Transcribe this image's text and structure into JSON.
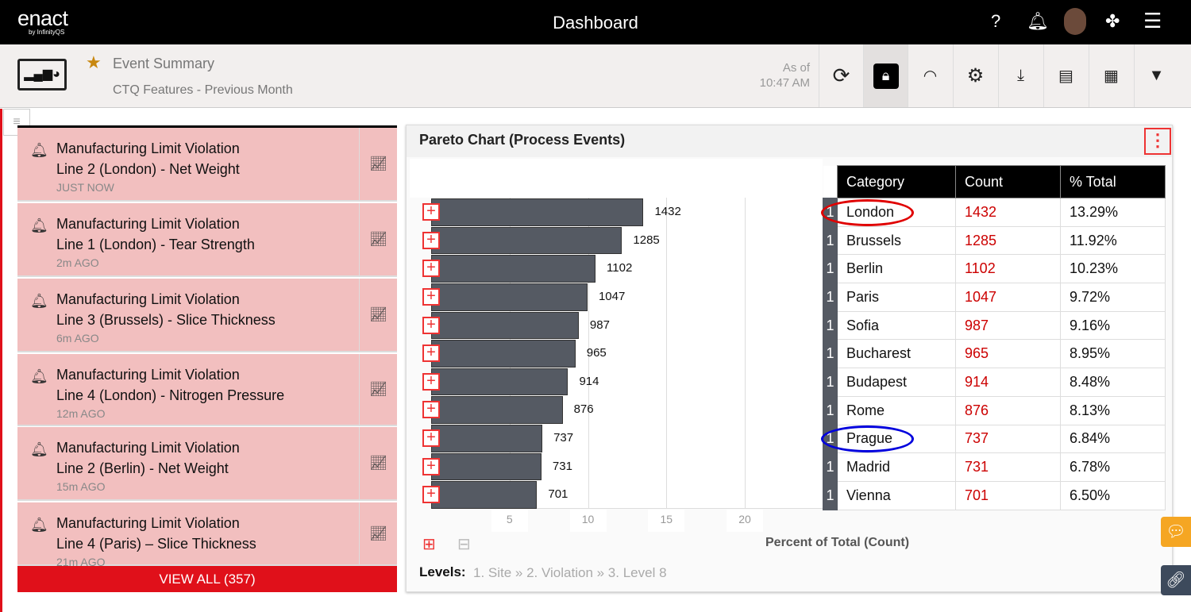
{
  "app": {
    "logo": "enact",
    "logo_sub": "by InfinityQS",
    "title": "Dashboard"
  },
  "topbar_icons": [
    "help-icon",
    "bell-icon",
    "avatar",
    "community-icon",
    "menu-icon"
  ],
  "header": {
    "title": "Event Summary",
    "subtitle": "CTQ Features - Previous Month",
    "as_of": "As of",
    "time": "10:47 AM",
    "favorite": true
  },
  "toolbar": [
    "refresh-icon",
    "lock-icon",
    "gauge-icon",
    "gear-icon",
    "download-icon",
    "document-icon",
    "report-filter-icon",
    "filter-icon"
  ],
  "events": [
    {
      "title": "Manufacturing Limit Violation",
      "detail": "Line 2 (London) - Net Weight",
      "time": "JUST NOW"
    },
    {
      "title": "Manufacturing Limit Violation",
      "detail": "Line 1 (London) - Tear Strength",
      "time": "2m AGO"
    },
    {
      "title": "Manufacturing Limit Violation",
      "detail": "Line 3 (Brussels) - Slice Thickness",
      "time": "6m AGO"
    },
    {
      "title": "Manufacturing Limit Violation",
      "detail": "Line 4 (London) - Nitrogen Pressure",
      "time": "12m AGO"
    },
    {
      "title": "Manufacturing Limit Violation",
      "detail": "Line 2 (Berlin) - Net Weight",
      "time": "15m AGO"
    },
    {
      "title": "Manufacturing Limit Violation",
      "detail": "Line 4 (Paris) – Slice Thickness",
      "time": "21m AGO"
    }
  ],
  "view_all": "VIEW ALL (357)",
  "panel": {
    "title": "Pareto Chart (Process Events)",
    "levels_label": "Levels:",
    "levels": "1. Site » 2. Violation » 3. Level 8"
  },
  "chart_data": {
    "type": "bar",
    "orientation": "horizontal",
    "xlabel": "Percent of Total (Count)",
    "xticks": [
      "5",
      "10",
      "15",
      "20"
    ],
    "xlim": [
      0,
      25
    ],
    "grid": true,
    "bar_color": "#555a63",
    "columns": [
      "Category",
      "Count",
      "% Total"
    ],
    "categories": [
      "London",
      "Brussels",
      "Berlin",
      "Paris",
      "Sofia",
      "Bucharest",
      "Budapest",
      "Rome",
      "Prague",
      "Madrid",
      "Vienna"
    ],
    "counts": [
      1432,
      1285,
      1102,
      1047,
      987,
      965,
      914,
      876,
      737,
      731,
      701
    ],
    "percent_labels": [
      "13.29%",
      "11.92%",
      "10.23%",
      "9.72%",
      "9.16%",
      "8.95%",
      "8.48%",
      "8.13%",
      "6.84%",
      "6.78%",
      "6.50%"
    ],
    "percents": [
      13.29,
      11.92,
      10.23,
      9.72,
      9.16,
      8.95,
      8.48,
      8.13,
      6.84,
      6.78,
      6.5
    ],
    "level": "1"
  },
  "annotations": [
    {
      "target": "London",
      "color": "#e00000"
    },
    {
      "target": "Prague",
      "color": "#0000dd"
    }
  ]
}
